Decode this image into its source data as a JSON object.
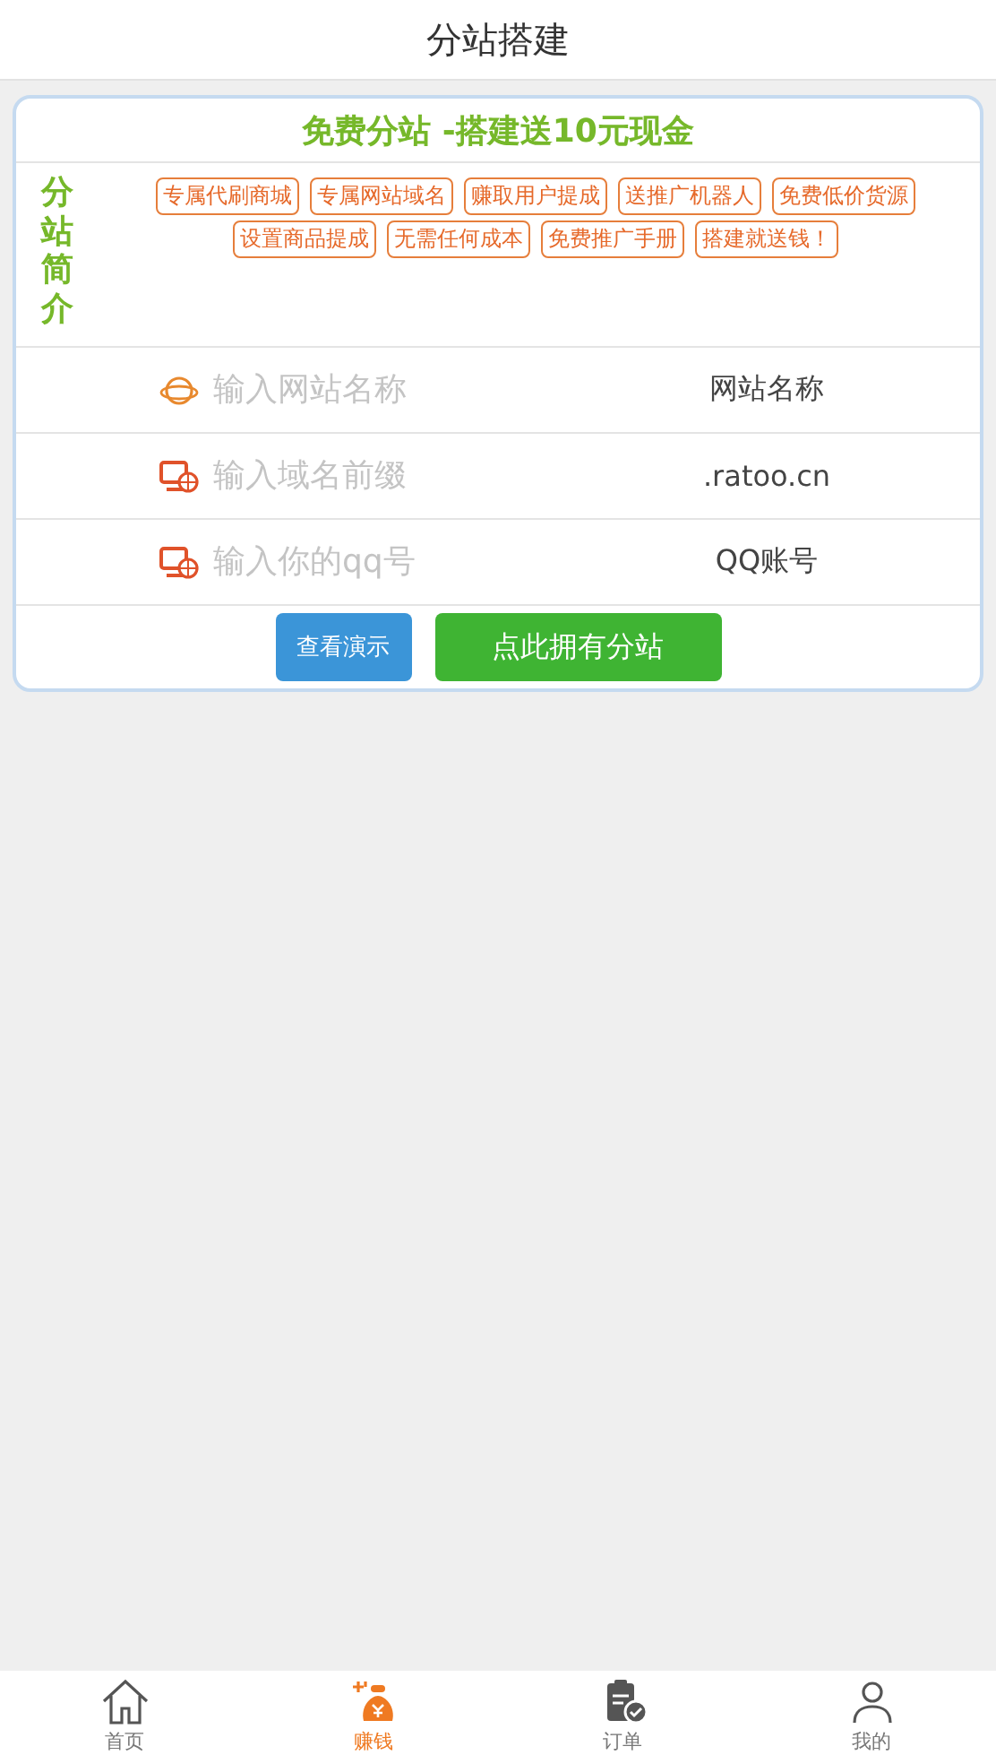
{
  "header": {
    "title": "分站搭建"
  },
  "card": {
    "title": "免费分站 -搭建送10元现金",
    "intro_label": "分站简介",
    "tags": [
      "专属代刷商城",
      "专属网站域名",
      "赚取用户提成",
      "送推广机器人",
      "免费低价货源",
      "设置商品提成",
      "无需任何成本",
      "免费推广手册",
      "搭建就送钱！"
    ],
    "fields": [
      {
        "kind": "globe",
        "placeholder": "输入网站名称",
        "suffix": "网站名称"
      },
      {
        "kind": "monitor",
        "placeholder": "输入域名前缀",
        "suffix": ".ratoo.cn"
      },
      {
        "kind": "monitor",
        "placeholder": "输入你的qq号",
        "suffix": "QQ账号"
      }
    ],
    "buttons": [
      {
        "kind": "demo",
        "label": "查看演示"
      },
      {
        "kind": "primary",
        "label": "点此拥有分站"
      }
    ]
  },
  "tab_bar": [
    {
      "kind": "home",
      "label": "首页",
      "selected": false
    },
    {
      "kind": "money",
      "label": "赚钱",
      "selected": true
    },
    {
      "kind": "orders",
      "label": "订单",
      "selected": false
    },
    {
      "kind": "me",
      "label": "我的",
      "selected": false
    }
  ]
}
